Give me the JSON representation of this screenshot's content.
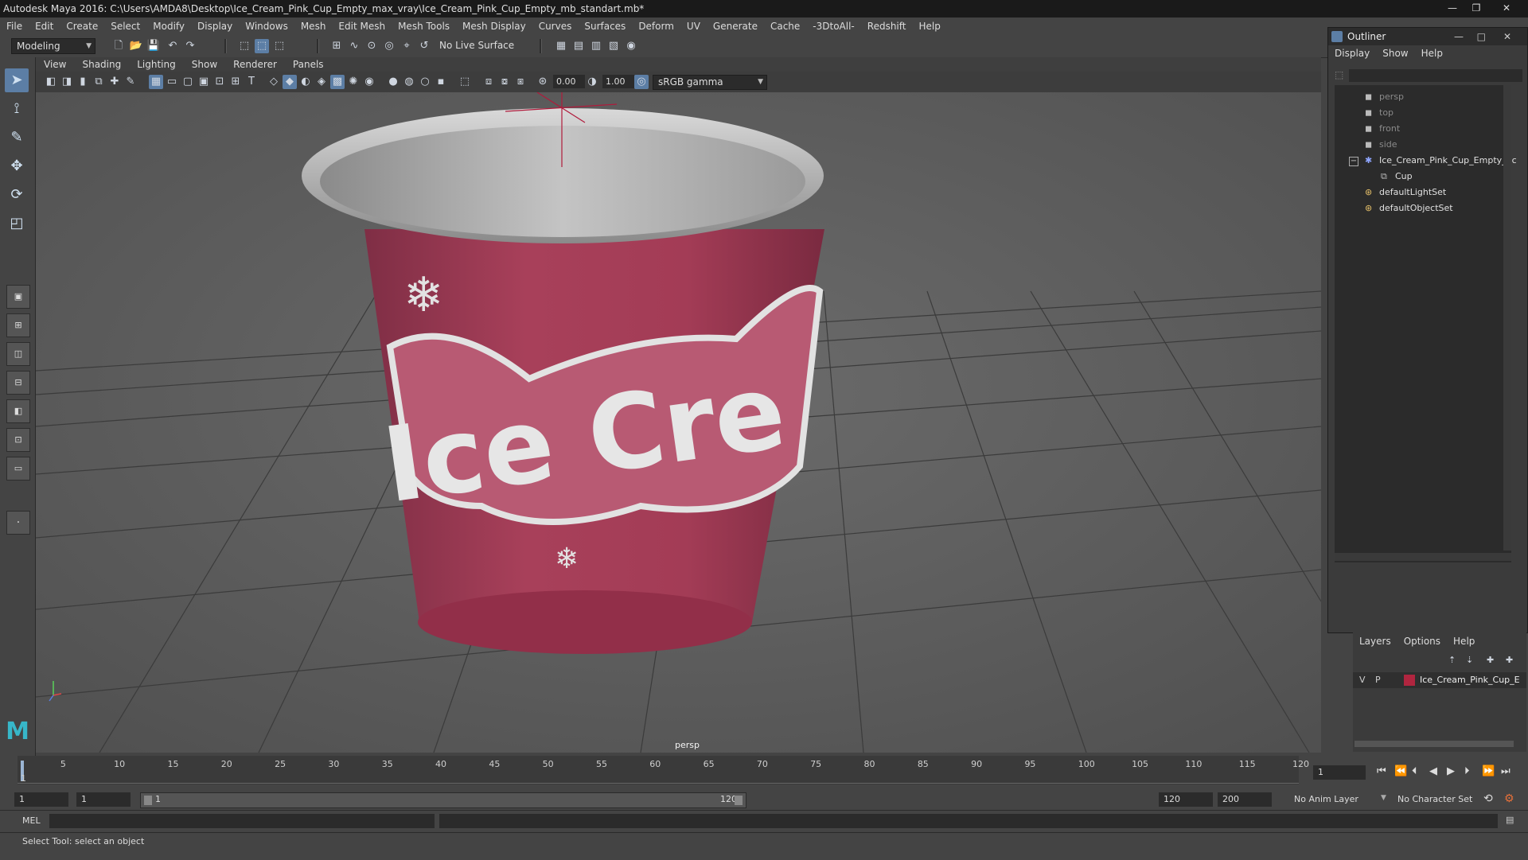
{
  "window": {
    "title": "Autodesk Maya 2016: C:\\Users\\AMDA8\\Desktop\\Ice_Cream_Pink_Cup_Empty_max_vray\\Ice_Cream_Pink_Cup_Empty_mb_standart.mb*",
    "buttons": [
      "—",
      "❐",
      "✕"
    ]
  },
  "menubar": [
    "File",
    "Edit",
    "Create",
    "Select",
    "Modify",
    "Display",
    "Windows",
    "Mesh",
    "Edit Mesh",
    "Mesh Tools",
    "Mesh Display",
    "Curves",
    "Surfaces",
    "Deform",
    "UV",
    "Generate",
    "Cache",
    "-3DtoAll-",
    "Redshift",
    "Help"
  ],
  "toolbar": {
    "mode": "Modeling",
    "live_surface": "No Live Surface"
  },
  "panel_menu": [
    "View",
    "Shading",
    "Lighting",
    "Show",
    "Renderer",
    "Panels"
  ],
  "viewport_tools": {
    "exposure": "0.00",
    "gamma": "1.00",
    "color_space": "sRGB gamma"
  },
  "viewport": {
    "camera_label": "persp",
    "model_text": "Ice Cre"
  },
  "outliner": {
    "title": "Outliner",
    "menu": [
      "Display",
      "Show",
      "Help"
    ],
    "items": [
      {
        "label": "persp",
        "icon": "camera-icon",
        "dim": true
      },
      {
        "label": "top",
        "icon": "camera-icon",
        "dim": true
      },
      {
        "label": "front",
        "icon": "camera-icon",
        "dim": true
      },
      {
        "label": "side",
        "icon": "camera-icon",
        "dim": true
      },
      {
        "label": "Ice_Cream_Pink_Cup_Empty_nc",
        "icon": "group-icon",
        "dim": false
      },
      {
        "label": "Cup",
        "icon": "mesh-icon",
        "dim": false
      },
      {
        "label": "defaultLightSet",
        "icon": "set-icon",
        "dim": false
      },
      {
        "label": "defaultObjectSet",
        "icon": "set-icon",
        "dim": false
      }
    ]
  },
  "layer_editor": {
    "menu": [
      "Layers",
      "Options",
      "Help"
    ],
    "layer": {
      "v": "V",
      "p": "P",
      "name": "Ice_Cream_Pink_Cup_E",
      "color": "#b0253f"
    }
  },
  "timeline": {
    "ticks": [
      "1",
      "5",
      "10",
      "15",
      "20",
      "25",
      "30",
      "35",
      "40",
      "45",
      "50",
      "55",
      "60",
      "65",
      "70",
      "75",
      "80",
      "85",
      "90",
      "95",
      "100",
      "105",
      "110",
      "115",
      "120"
    ],
    "current_frame": "1"
  },
  "range": {
    "start": "1",
    "anim_start": "1",
    "slider_start": "1",
    "slider_end": "120",
    "anim_end": "120",
    "end": "200",
    "anim_layer": "No Anim Layer",
    "character_set": "No Character Set"
  },
  "cmdline": {
    "label": "MEL"
  },
  "status": {
    "text": "Select Tool: select an object"
  },
  "colors": {
    "cup_pink": "#a8405a",
    "cup_rim": "#c8c8c8",
    "select_blue": "#5c7ea5"
  }
}
